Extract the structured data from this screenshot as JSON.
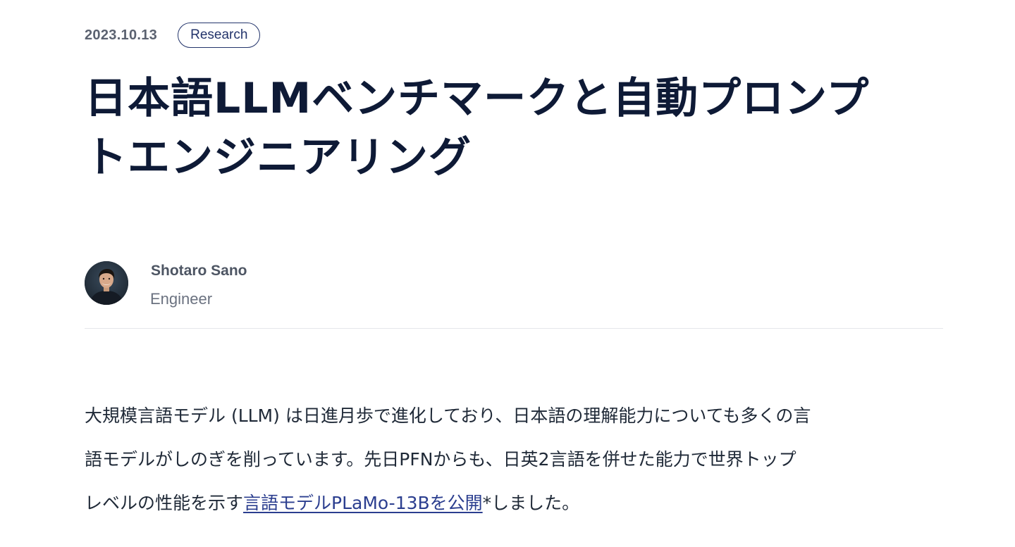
{
  "post": {
    "date": "2023.10.13",
    "category": "Research",
    "title_lines": [
      "日本語LLMベンチマークと自動プロンプ",
      "トエンジニアリング"
    ]
  },
  "author": {
    "name": "Shotaro Sano",
    "role": "Engineer"
  },
  "body": {
    "line1": "大規模言語モデル (LLM) は日進月歩で進化しており、日本語の理解能力についても多くの言",
    "line2": "語モデルがしのぎを削っています。先日PFNからも、日英2言語を併せた能力で世界トップ",
    "line3_before": "レベルの性能を示す",
    "line3_link": "言語モデルPLaMo-13Bを公開",
    "line3_after": "*しました。"
  },
  "colors": {
    "title": "#0e1a36",
    "tag_border": "#23346b",
    "link": "#2b3e8f",
    "meta_gray": "#5b6270"
  }
}
